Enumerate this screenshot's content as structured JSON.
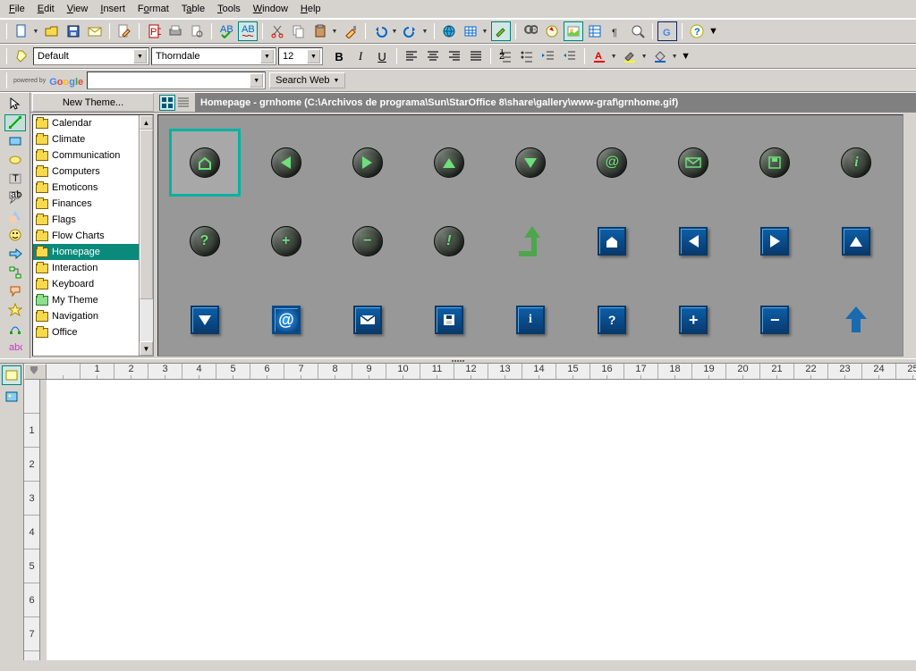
{
  "menu": [
    "File",
    "Edit",
    "View",
    "Insert",
    "Format",
    "Table",
    "Tools",
    "Window",
    "Help"
  ],
  "format_toolbar": {
    "style": "Default",
    "font": "Thorndale",
    "size": "12"
  },
  "google": {
    "powered": "powered by",
    "button": "Search Web"
  },
  "gallery": {
    "new_theme": "New Theme...",
    "path": "Homepage - grnhome (C:\\Archivos de programa\\Sun\\StarOffice 8\\share\\gallery\\www-graf\\grnhome.gif)",
    "themes": [
      "Calendar",
      "Climate",
      "Communication",
      "Computers",
      "Emoticons",
      "Finances",
      "Flags",
      "Flow Charts",
      "Homepage",
      "Interaction",
      "Keyboard",
      "My Theme",
      "Navigation",
      "Office"
    ],
    "selected_theme": "Homepage"
  },
  "ruler_h": [
    "",
    "1",
    "2",
    "3",
    "4",
    "5",
    "6",
    "7",
    "8",
    "9",
    "10",
    "11",
    "12",
    "13",
    "14",
    "15",
    "16",
    "17",
    "18",
    "19",
    "20",
    "21",
    "22",
    "23",
    "24",
    "25"
  ],
  "ruler_v": [
    "",
    "1",
    "2",
    "3",
    "4",
    "5",
    "6",
    "7"
  ]
}
